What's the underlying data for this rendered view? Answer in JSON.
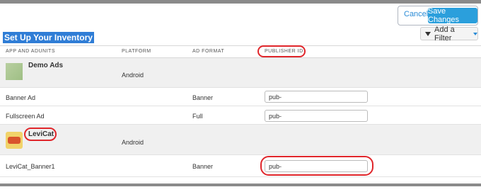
{
  "toolbar": {
    "cancel_label": "Cancel",
    "save_label": "Save Changes"
  },
  "page": {
    "title": "Set Up Your Inventory",
    "filter_label": "Add a Filter"
  },
  "columns": [
    "APP AND ADUNITS",
    "PLATFORM",
    "AD FORMAT",
    "PUBLISHER ID"
  ],
  "apps": [
    {
      "name": "Demo Ads",
      "platform": "Android",
      "adunits": [
        {
          "name": "Banner Ad",
          "format": "Banner",
          "publisher_id": "pub-"
        },
        {
          "name": "Fullscreen Ad",
          "format": "Full",
          "publisher_id": "pub-"
        }
      ]
    },
    {
      "name": "LeviCat",
      "platform": "Android",
      "adunits": [
        {
          "name": "LeviCat_Banner1",
          "format": "Banner",
          "publisher_id": "pub-"
        }
      ]
    }
  ],
  "colors": {
    "accent": "#2b9fdc",
    "title_highlight": "#2f7dd6",
    "annotation": "#e0262b"
  },
  "icons": {
    "filter": "funnel-icon",
    "dropdown": "caret-down-icon"
  }
}
